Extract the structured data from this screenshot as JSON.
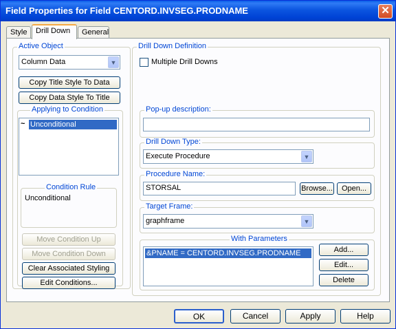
{
  "window": {
    "title": "Field Properties for Field  CENTORD.INVSEG.PRODNAME"
  },
  "tabs": [
    {
      "label": "Style"
    },
    {
      "label": "Drill Down"
    },
    {
      "label": "General"
    }
  ],
  "active_object": {
    "legend": "Active Object",
    "selected": "Column Data",
    "copy_title_label": "Copy Title Style To Data",
    "copy_data_label": "Copy Data Style To Title"
  },
  "applying": {
    "legend": "Applying to Condition",
    "item": "Unconditional",
    "rule_legend": "Condition Rule",
    "rule_text": "Unconditional",
    "move_up_label": "Move Condition Up",
    "move_down_label": "Move Condition Down",
    "clear_label": "Clear Associated Styling",
    "edit_label": "Edit Conditions..."
  },
  "drill": {
    "legend": "Drill Down Definition",
    "multiple_label": "Multiple Drill Downs",
    "popup_legend": "Pop-up description:",
    "popup_value": "",
    "type_legend": "Drill Down Type:",
    "type_value": "Execute Procedure",
    "proc_legend": "Procedure Name:",
    "proc_value": "STORSAL",
    "browse_label": "Browse...",
    "open_label": "Open...",
    "frame_legend": "Target Frame:",
    "frame_value": "graphframe",
    "params_legend": "With Parameters",
    "param_item": "&PNAME = CENTORD.INVSEG.PRODNAME",
    "add_label": "Add...",
    "edit_label": "Edit...",
    "delete_label": "Delete"
  },
  "footer": {
    "ok": "OK",
    "cancel": "Cancel",
    "apply": "Apply",
    "help": "Help"
  }
}
